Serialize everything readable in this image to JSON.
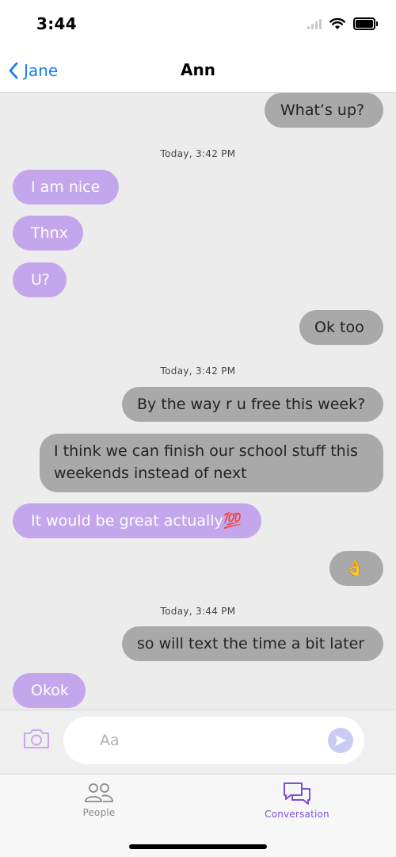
{
  "status_bar": {
    "time": "3:44",
    "icons": [
      "signal-icon",
      "wifi-icon",
      "battery-icon"
    ]
  },
  "nav": {
    "back_label": "Jane",
    "title": "Ann"
  },
  "messages": [
    {
      "kind": "out",
      "text": "What’s up?"
    },
    {
      "kind": "stamp",
      "text": "Today, 3:42 PM"
    },
    {
      "kind": "in",
      "text": "I am nice"
    },
    {
      "kind": "in",
      "text": "Thnx"
    },
    {
      "kind": "in",
      "text": "U?"
    },
    {
      "kind": "out",
      "text": "Ok too"
    },
    {
      "kind": "stamp",
      "text": "Today, 3:42 PM"
    },
    {
      "kind": "out",
      "text": "By the way r u free this week?"
    },
    {
      "kind": "out",
      "text": "I think we can finish our school stuff this weekends instead of next"
    },
    {
      "kind": "in",
      "text": "It would be great actually💯"
    },
    {
      "kind": "out",
      "text": "👌"
    },
    {
      "kind": "stamp",
      "text": "Today, 3:44 PM"
    },
    {
      "kind": "out",
      "text": "so will text the time a bit later"
    },
    {
      "kind": "in",
      "text": "Okok"
    }
  ],
  "input": {
    "placeholder": "Aa",
    "value": ""
  },
  "tabs": [
    {
      "label": "People",
      "icon": "people-icon",
      "active": false
    },
    {
      "label": "Conversation",
      "icon": "chat-bubbles-icon",
      "active": true
    }
  ],
  "colors": {
    "accent_blue": "#1a7cf2",
    "incoming_bubble": "#c3a6ec",
    "outgoing_bubble": "#a9a9a9",
    "active_tab": "#7b4fd8"
  }
}
